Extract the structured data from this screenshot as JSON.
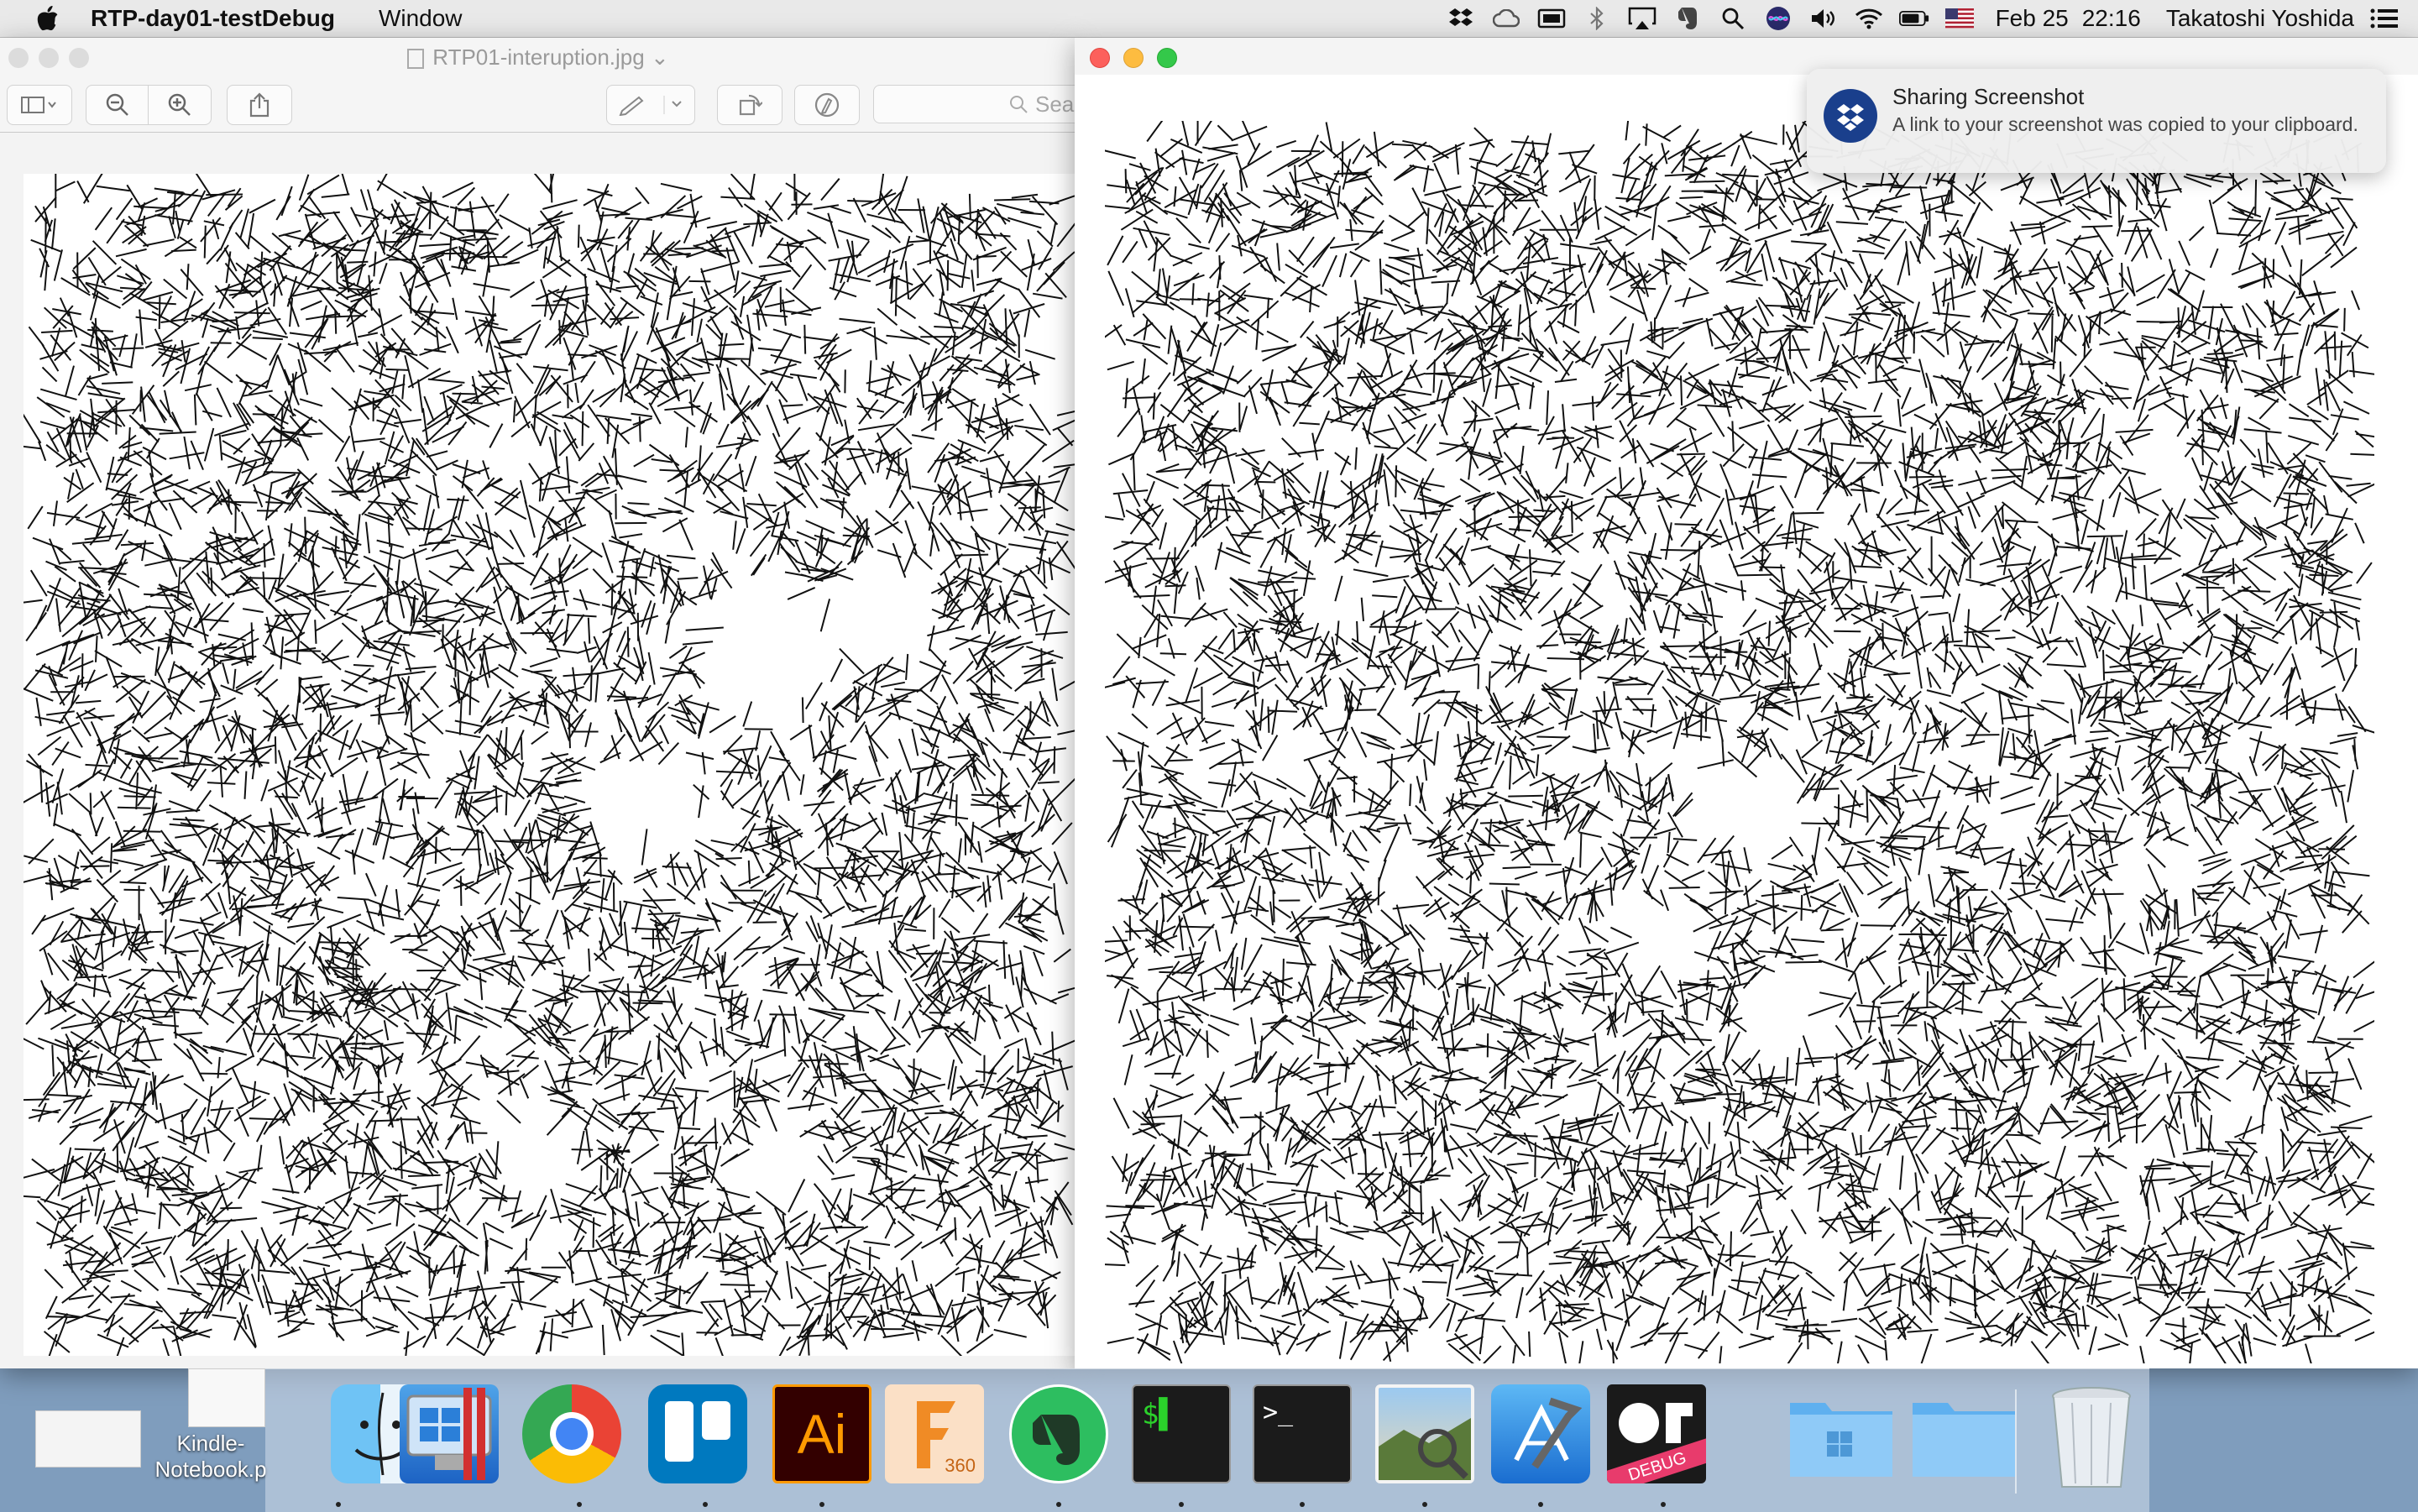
{
  "menubar": {
    "app_name": "RTP-day01-testDebug",
    "menus": [
      "Window"
    ],
    "date": "Feb 25",
    "time": "22:16",
    "user": "Takatoshi Yoshida",
    "status_icons": [
      "dropbox-icon",
      "creative-cloud-icon",
      "screen-icon",
      "bluetooth-icon",
      "airplay-icon",
      "evernote-icon",
      "search-icon",
      "siri-icon",
      "volume-icon",
      "wifi-icon",
      "battery-icon",
      "flag-us-icon",
      "list-icon"
    ]
  },
  "preview_window": {
    "title": "RTP01-interuption.jpg",
    "search_placeholder": "Sea"
  },
  "notification": {
    "title": "Sharing Screenshot",
    "body": "A link to your screenshot was copied to your clipboard."
  },
  "desktop": {
    "kindle_label_line1": "Kindle-",
    "kindle_label_line2": "Notebook.p"
  },
  "dock": {
    "apps": [
      "Finder",
      "Boot Camp",
      "Chrome",
      "Trello",
      "Illustrator",
      "Fusion 360",
      "Evernote",
      "Terminal",
      "Terminal 2",
      "Preview",
      "Xcode",
      "openFrameworks",
      "Folder 1",
      "Folder 2",
      "Trash"
    ],
    "illustrator_label": "Ai",
    "fusion_label": "360",
    "of_label": "DEBUG"
  },
  "colors": {
    "close": "#fc605c",
    "minimize": "#fdbc40",
    "zoom": "#34c84a",
    "illustrator_bg": "#330000",
    "illustrator_fg": "#ff9a00",
    "fusion": "#f08b25",
    "evernote": "#2dbe60"
  }
}
